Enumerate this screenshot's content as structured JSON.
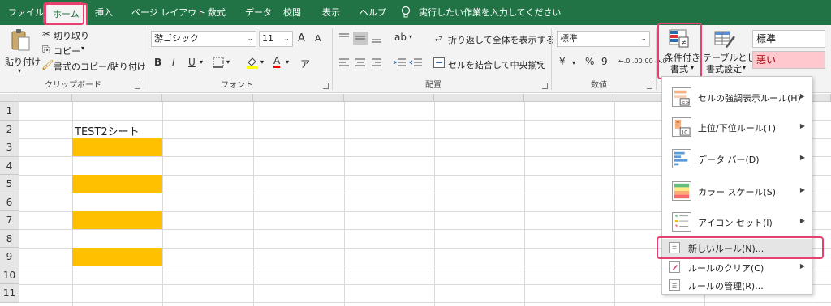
{
  "tabs": [
    {
      "label": "ファイル"
    },
    {
      "label": "ホーム"
    },
    {
      "label": "挿入"
    },
    {
      "label": "ページ レイアウト"
    },
    {
      "label": "数式"
    },
    {
      "label": "データ"
    },
    {
      "label": "校閲"
    },
    {
      "label": "表示"
    },
    {
      "label": "ヘルプ"
    }
  ],
  "tell_me": "実行したい作業を入力してください",
  "clipboard": {
    "paste": "貼り付け",
    "cut": "切り取り",
    "copy": "コピー",
    "format_painter": "書式のコピー/貼り付け",
    "group": "クリップボード"
  },
  "font": {
    "name": "游ゴシック",
    "size": "11",
    "group": "フォント",
    "bold": "B",
    "italic": "I",
    "underline": "U",
    "grow": "A",
    "shrink": "A",
    "color": "A"
  },
  "alignment": {
    "wrap": "折り返して全体を表示する",
    "merge": "セルを結合して中央揃え",
    "group": "配置"
  },
  "number": {
    "format": "標準",
    "percent": "%",
    "comma": "9",
    "increase": "←.0 .00",
    "decrease": ".00 →.0",
    "group": "数値",
    "currency_symbol": "¥"
  },
  "styles": {
    "conditional": "条件付き\n書式",
    "table_line1": "テーブルとして",
    "table_line2": "書式設定",
    "normal": "標準",
    "bad": "悪い",
    "cond_line1": "条件付き",
    "cond_line2": "書式"
  },
  "sheet": {
    "rows": [
      "1",
      "2",
      "3",
      "4",
      "5",
      "6",
      "7",
      "8",
      "9",
      "10",
      "11"
    ],
    "b2": "TEST2シート"
  },
  "menu": {
    "items": [
      {
        "label": "セルの強調表示ルール(H)"
      },
      {
        "label": "上位/下位ルール(T)"
      },
      {
        "label": "データ バー(D)"
      },
      {
        "label": "カラー スケール(S)"
      },
      {
        "label": "アイコン セット(I)"
      },
      {
        "label": "新しいルール(N)..."
      },
      {
        "label": "ルールのクリア(C)"
      },
      {
        "label": "ルールの管理(R)..."
      }
    ],
    "icon_texts": {
      "top10": "10"
    }
  },
  "colors": {
    "ribbon_green": "#217346",
    "highlight": "#e8406e",
    "fill_yellow": "#ffc000",
    "bad_bg": "#ffc7ce",
    "bad_text": "#9c0006"
  }
}
